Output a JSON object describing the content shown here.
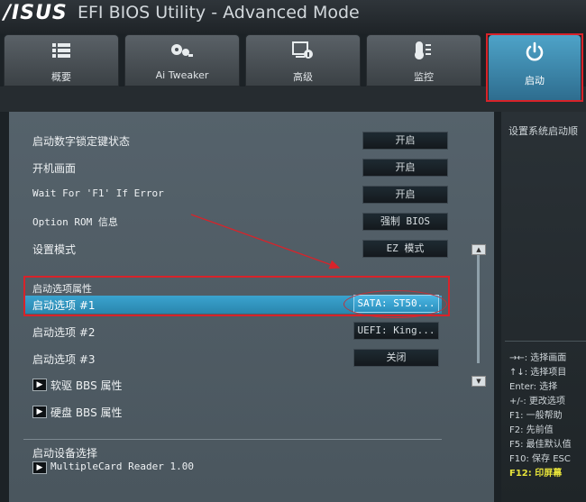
{
  "header": {
    "logo": "/ISUS",
    "title": "EFI BIOS Utility - Advanced Mode"
  },
  "tabs": [
    {
      "label": "概要",
      "icon": "list-icon"
    },
    {
      "label": "Ai Tweaker",
      "icon": "tweaker-icon"
    },
    {
      "label": "高级",
      "icon": "advanced-icon"
    },
    {
      "label": "监控",
      "icon": "thermometer-icon"
    },
    {
      "label": "启动",
      "icon": "power-icon"
    }
  ],
  "settings": [
    {
      "label": "启动数字锁定键状态",
      "value": "开启"
    },
    {
      "label": "开机画面",
      "value": "开启"
    },
    {
      "label": "Wait For 'F1' If Error",
      "value": "开启"
    },
    {
      "label": "Option ROM 信息",
      "value": "强制 BIOS"
    },
    {
      "label": "设置模式",
      "value": "EZ 模式"
    }
  ],
  "boot_priority": {
    "section_label": "启动选项属性",
    "option1_label": "启动选项 #1",
    "option1_value": "SATA: ST50...",
    "option2_label": "启动选项 #2",
    "option2_value": "UEFI: King...",
    "option3_label": "启动选项 #3",
    "option3_value": "关闭"
  },
  "submenus": {
    "floppy": "软驱 BBS 属性",
    "hdd": "硬盘 BBS 属性"
  },
  "override": {
    "section_label": "启动设备选择",
    "item": "MultipleCard Reader 1.00"
  },
  "help": {
    "description": "设置系统启动顺",
    "keys": [
      "→←: 选择画面",
      "↑↓: 选择项目",
      "Enter: 选择",
      "+/-: 更改选项",
      "F1: 一般帮助",
      "F2: 先前值",
      "F5: 最佳默认值",
      "F10: 保存  ESC"
    ],
    "f12": "F12: 印屏幕"
  },
  "colors": {
    "accent": "#2e93c2",
    "annotation_red": "#d8232a"
  }
}
